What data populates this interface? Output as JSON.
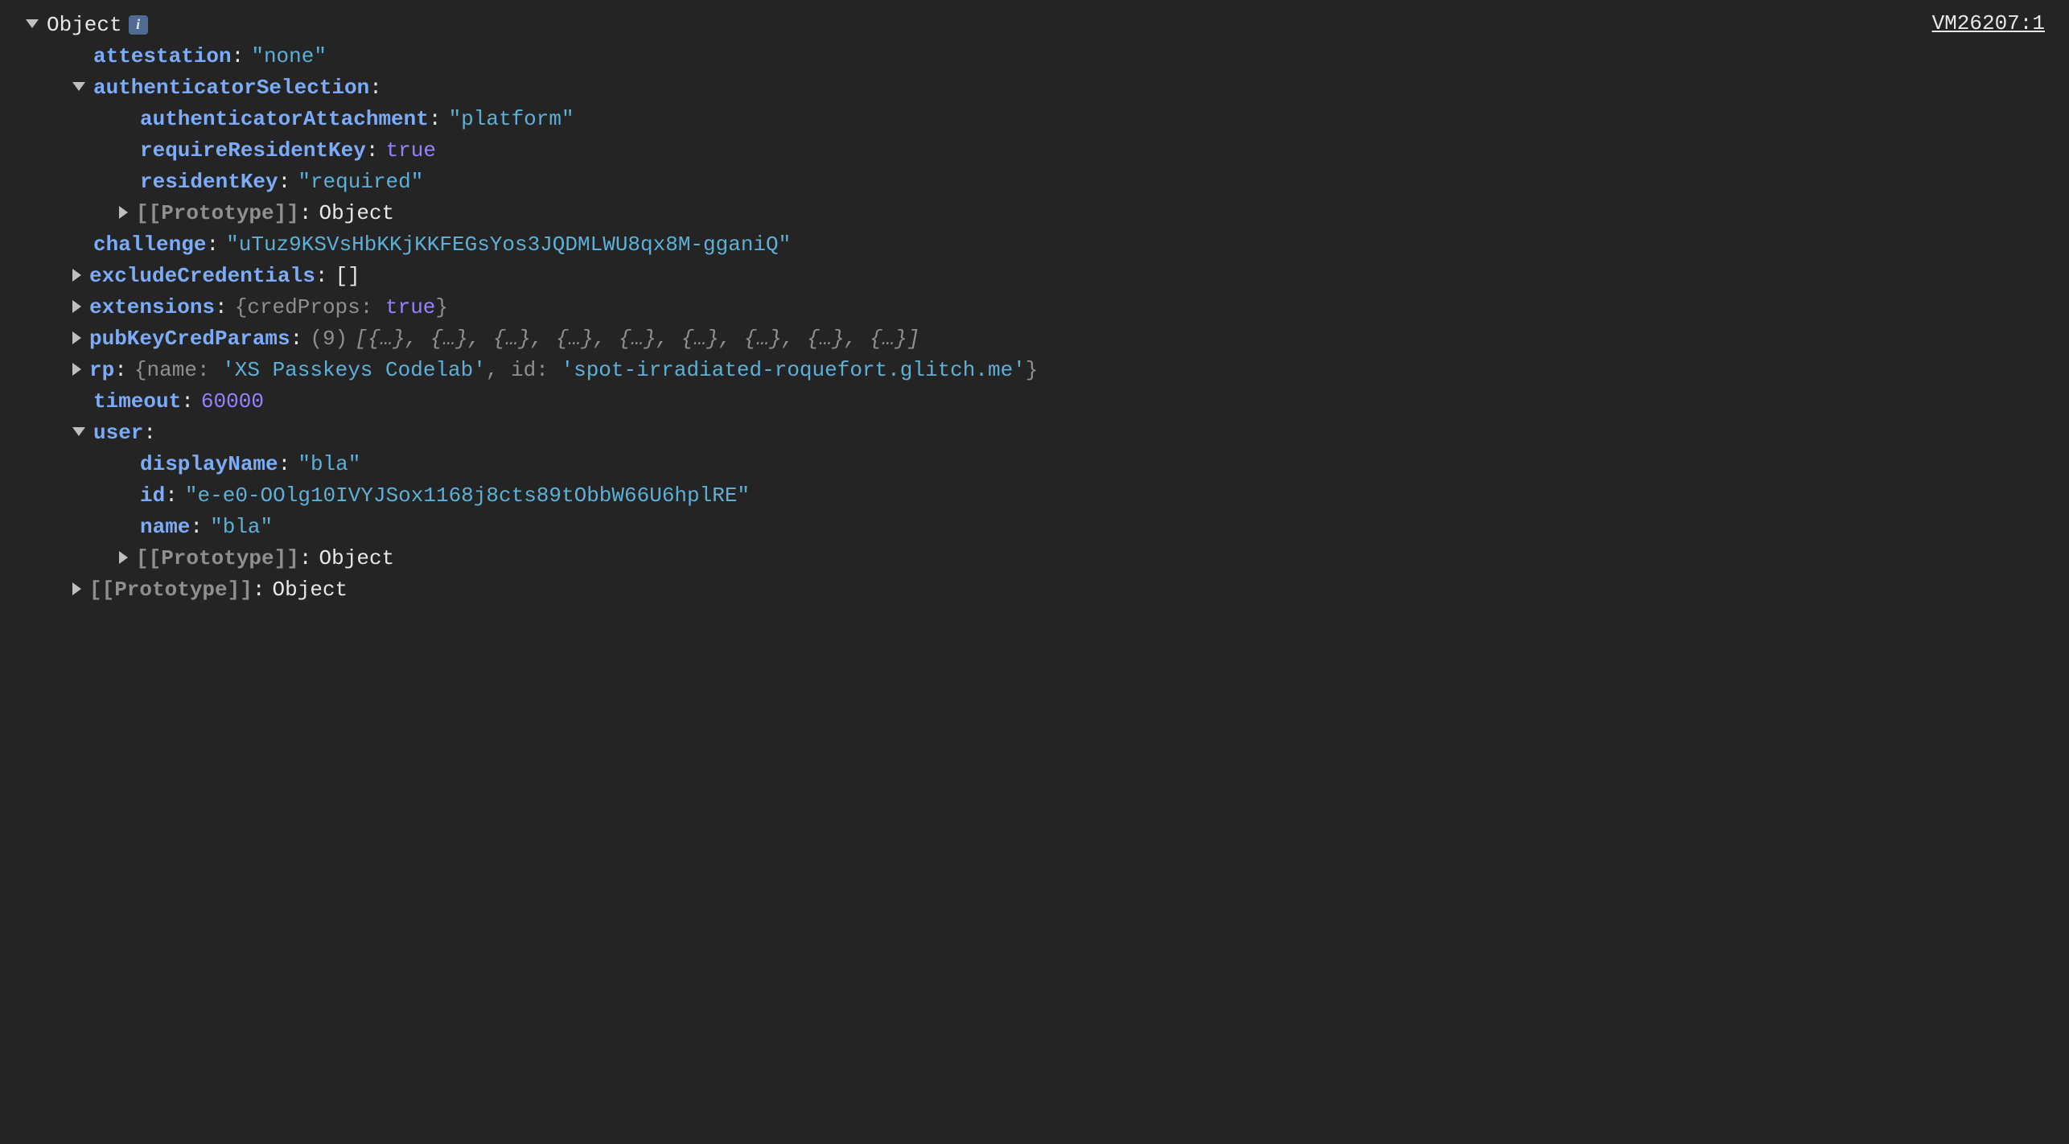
{
  "source": "VM26207:1",
  "root": "Object",
  "infoGlyph": "i",
  "attestation": {
    "key": "attestation",
    "value": "\"none\""
  },
  "authenticatorSelection": {
    "key": "authenticatorSelection",
    "authenticatorAttachment": {
      "key": "authenticatorAttachment",
      "value": "\"platform\""
    },
    "requireResidentKey": {
      "key": "requireResidentKey",
      "value": "true"
    },
    "residentKey": {
      "key": "residentKey",
      "value": "\"required\""
    },
    "prototype": {
      "key": "[[Prototype]]",
      "value": "Object"
    }
  },
  "challenge": {
    "key": "challenge",
    "value": "\"uTuz9KSVsHbKKjKKFEGsYos3JQDMLWU8qx8M-gganiQ\""
  },
  "excludeCredentials": {
    "key": "excludeCredentials",
    "value": "[]"
  },
  "extensions": {
    "key": "extensions",
    "previewPrefix": "{",
    "previewKey": "credProps",
    "previewValue": "true",
    "previewSuffix": "}"
  },
  "pubKeyCredParams": {
    "key": "pubKeyCredParams",
    "count": "(9)",
    "preview": "[{…}, {…}, {…}, {…}, {…}, {…}, {…}, {…}, {…}]"
  },
  "rp": {
    "key": "rp",
    "previewPrefix": "{",
    "nameKey": "name",
    "nameValue": "'XS Passkeys Codelab'",
    "idKey": "id",
    "idValue": "'spot-irradiated-roquefort.glitch.me'",
    "previewSuffix": "}"
  },
  "timeout": {
    "key": "timeout",
    "value": "60000"
  },
  "user": {
    "key": "user",
    "displayName": {
      "key": "displayName",
      "value": "\"bla\""
    },
    "id": {
      "key": "id",
      "value": "\"e-e0-OOlg10IVYJSox1168j8cts89tObbW66U6hplRE\""
    },
    "name": {
      "key": "name",
      "value": "\"bla\""
    },
    "prototype": {
      "key": "[[Prototype]]",
      "value": "Object"
    }
  },
  "prototype": {
    "key": "[[Prototype]]",
    "value": "Object"
  }
}
